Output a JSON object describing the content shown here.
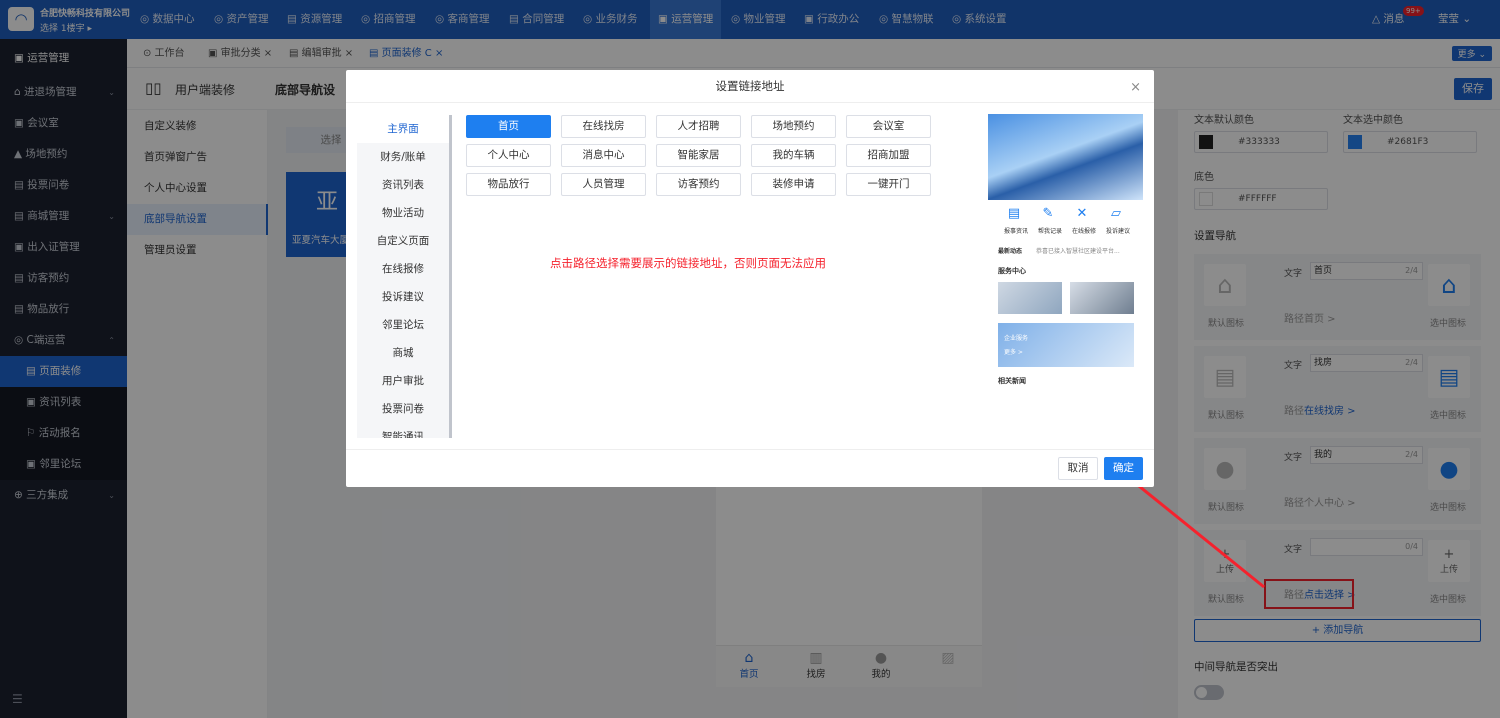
{
  "topbar": {
    "company": "合肥快畅科技有限公司",
    "building": "选择 1楼宇 ▸",
    "nav": [
      {
        "label": "◎ 数据中心"
      },
      {
        "label": "◎ 资产管理"
      },
      {
        "label": "▤ 资源管理"
      },
      {
        "label": "◎ 招商管理"
      },
      {
        "label": "◎ 客商管理"
      },
      {
        "label": "▤ 合同管理"
      },
      {
        "label": "◎ 业务财务"
      },
      {
        "label": "▣ 运营管理"
      },
      {
        "label": "◎ 物业管理"
      },
      {
        "label": "▣ 行政办公"
      },
      {
        "label": "◎ 智慧物联"
      },
      {
        "label": "◎ 系统设置"
      }
    ],
    "messages": "△ 消息",
    "badge": "99+",
    "user": "莹莹 ⌄"
  },
  "sidebar": {
    "items": [
      {
        "label": "▣ 运营管理"
      },
      {
        "label": "⌂ 进退场管理"
      },
      {
        "label": "▣ 会议室"
      },
      {
        "label": "▲ 场地预约"
      },
      {
        "label": "▤ 投票问卷"
      },
      {
        "label": "▤ 商城管理"
      },
      {
        "label": "▣ 出入证管理"
      },
      {
        "label": "▤ 访客预约"
      },
      {
        "label": "▤ 物品放行"
      },
      {
        "label": "◎ C端运营"
      },
      {
        "label": "▤ 页面装修"
      },
      {
        "label": "▣ 资讯列表"
      },
      {
        "label": "⚐ 活动报名"
      },
      {
        "label": "▣ 邻里论坛"
      },
      {
        "label": "⊕ 三方集成"
      }
    ],
    "collapse": "☰"
  },
  "tabs": [
    {
      "label": "⊙ 工作台"
    },
    {
      "label": "▣ 审批分类 ×"
    },
    {
      "label": "▤ 编辑审批 ×"
    },
    {
      "label": "▤ 页面装修 C ×"
    }
  ],
  "more": "更多 ⌄",
  "page": {
    "header": "用户端装修",
    "subheader": "底部导航设",
    "save": "保存",
    "select_btn": "选择",
    "banner_char": "亚",
    "banner_text": "亚夏汽车大厦"
  },
  "leftnav": {
    "items": [
      {
        "label": "自定义装修"
      },
      {
        "label": "首页弹窗广告"
      },
      {
        "label": "个人中心设置"
      },
      {
        "label": "底部导航设置"
      },
      {
        "label": "管理员设置"
      }
    ]
  },
  "panel": {
    "text_default_color_label": "文本默认颜色",
    "text_default_color": "#333333",
    "text_selected_color_label": "文本选中颜色",
    "text_selected_color": "#2681F3",
    "bg_label": "底色",
    "bg_color": "#FFFFFF",
    "setup_nav": "设置导航",
    "text_label": "文字",
    "path_label": "路径",
    "default_icon": "默认图标",
    "selected_icon": "选中图标",
    "upload": "上传",
    "cards": [
      {
        "text": "首页",
        "count": "2/4",
        "path": "首页 >"
      },
      {
        "text": "找房",
        "count": "2/4",
        "path": "在线找房 >"
      },
      {
        "text": "我的",
        "count": "2/4",
        "path": "个人中心 >"
      },
      {
        "text": "",
        "count": "0/4",
        "path": "点击选择 >"
      }
    ],
    "add_nav": "+ 添加导航",
    "mid_nav": "中间导航是否突出"
  },
  "phone_nav": [
    {
      "label": "首页"
    },
    {
      "label": "找房"
    },
    {
      "label": "我的"
    }
  ],
  "modal": {
    "title": "设置链接地址",
    "close": "×",
    "categories": [
      {
        "label": "主界面"
      },
      {
        "label": "财务/账单"
      },
      {
        "label": "资讯列表"
      },
      {
        "label": "物业活动"
      },
      {
        "label": "自定义页面"
      },
      {
        "label": "在线报修"
      },
      {
        "label": "投诉建议"
      },
      {
        "label": "邻里论坛"
      },
      {
        "label": "商城"
      },
      {
        "label": "用户审批"
      },
      {
        "label": "投票问卷"
      },
      {
        "label": "智能通讯"
      }
    ],
    "links": [
      {
        "label": "首页"
      },
      {
        "label": "在线找房"
      },
      {
        "label": "人才招聘"
      },
      {
        "label": "场地预约"
      },
      {
        "label": "会议室"
      },
      {
        "label": "个人中心"
      },
      {
        "label": "消息中心"
      },
      {
        "label": "智能家居"
      },
      {
        "label": "我的车辆"
      },
      {
        "label": "招商加盟"
      },
      {
        "label": "物品放行"
      },
      {
        "label": "人员管理"
      },
      {
        "label": "访客预约"
      },
      {
        "label": "装修申请"
      },
      {
        "label": "一键开门"
      }
    ],
    "hint": "点击路径选择需要展示的链接地址，否则页面无法应用",
    "cancel": "取消",
    "ok": "确定",
    "preview": {
      "icons": [
        {
          "label": "报事资讯"
        },
        {
          "label": "帮我记录"
        },
        {
          "label": "在线报修"
        },
        {
          "label": "投诉建议"
        }
      ],
      "news_label": "最新动态",
      "news_text": "恭喜已接入智慧社区建设平台...",
      "service_center": "服务中心",
      "enterprise_service": "企业服务",
      "more": "更多 >",
      "related": "相关新闻"
    }
  },
  "colors": {
    "brand": "#1f5fbf",
    "accent": "#1e7ff0",
    "warning": "#f5222d",
    "sidebar_bg": "#1d2230"
  }
}
